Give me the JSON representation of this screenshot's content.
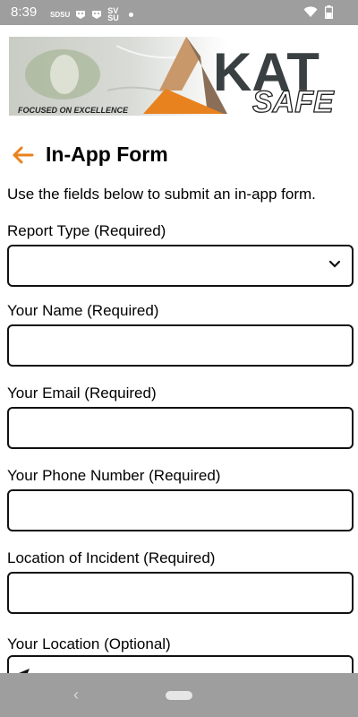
{
  "status_bar": {
    "time": "8:39",
    "left_icons": [
      "SDSU",
      "badge-icon",
      "badge-icon",
      "SV SU"
    ],
    "right_icons": [
      "wifi-icon",
      "battery-icon"
    ]
  },
  "banner": {
    "tagline": "FOCUSED ON EXCELLENCE",
    "logo_text": "KAT",
    "logo_subtext": "SAFE"
  },
  "header": {
    "title": "In-App Form",
    "back_icon": "arrow-left-icon",
    "accent_color": "#e8821e"
  },
  "intro": "Use the fields below to submit an in-app form.",
  "fields": [
    {
      "label": "Report Type (Required)",
      "type": "select",
      "value": ""
    },
    {
      "label": "Your Name (Required)",
      "type": "text",
      "value": ""
    },
    {
      "label": "Your Email (Required)",
      "type": "text",
      "value": ""
    },
    {
      "label": "Your Phone Number (Required)",
      "type": "text",
      "value": ""
    },
    {
      "label": "Location of Incident (Required)",
      "type": "text",
      "value": ""
    },
    {
      "label": "Your Location (Optional)",
      "type": "text",
      "value": ""
    }
  ]
}
